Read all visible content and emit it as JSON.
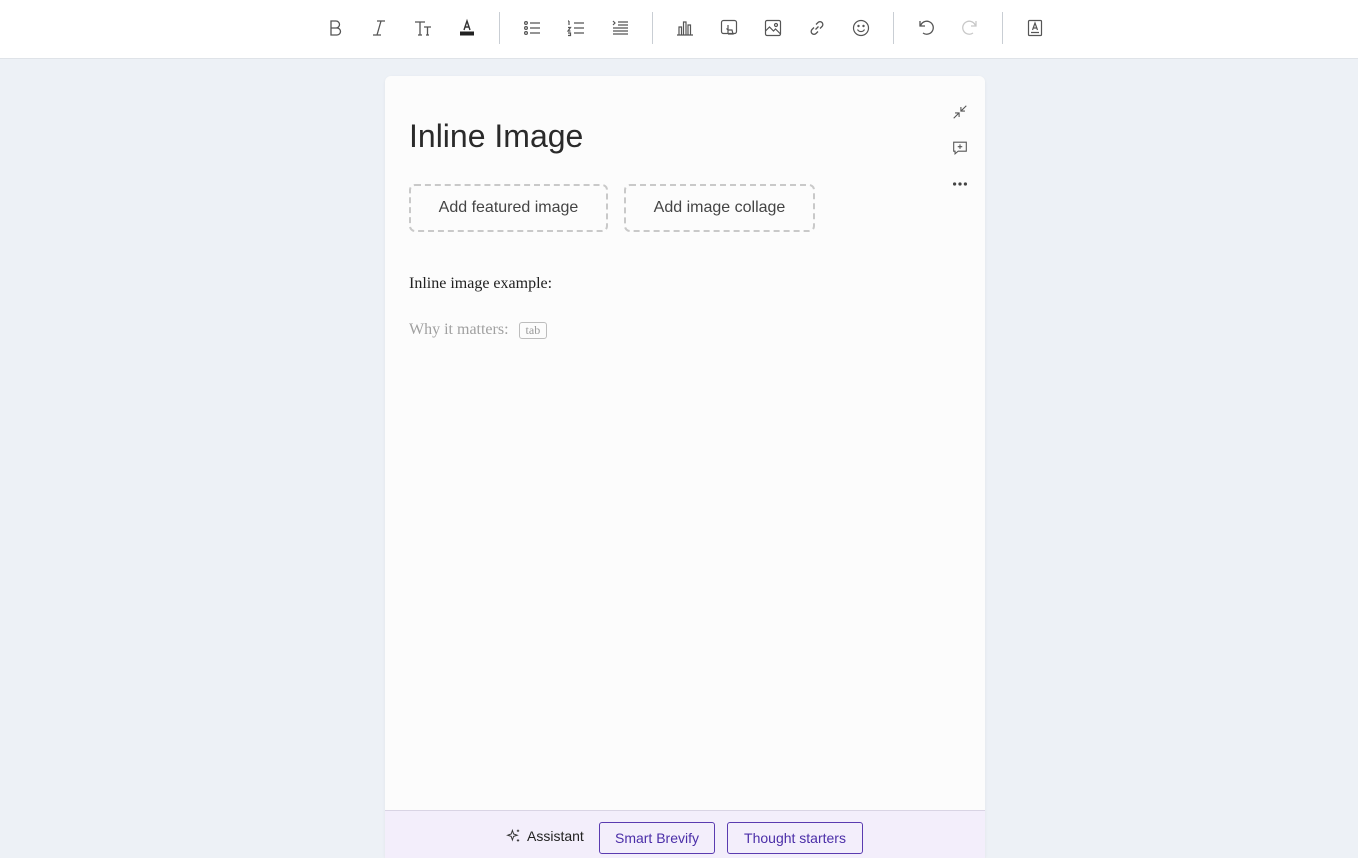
{
  "toolbar": {
    "groups": [
      [
        "bold-icon",
        "italic-icon",
        "text-size-icon",
        "text-color-icon"
      ],
      [
        "bullet-list-icon",
        "numbered-list-icon",
        "indent-list-icon"
      ],
      [
        "chart-icon",
        "interactive-icon",
        "image-icon",
        "link-icon",
        "emoji-icon"
      ],
      [
        "undo-icon",
        "redo-icon"
      ],
      [
        "text-box-icon"
      ]
    ]
  },
  "document": {
    "title": "Inline Image",
    "featured_image_label": "Add featured image",
    "image_collage_label": "Add image collage",
    "body_text": "Inline image example:",
    "placeholder_text": "Why it matters:",
    "tab_hint": "tab"
  },
  "bottom_bar": {
    "assistant_label": "Assistant",
    "smart_brevify_label": "Smart Brevify",
    "thought_starters_label": "Thought starters"
  },
  "colors": {
    "accent": "#4b2ea8",
    "background": "#edf1f6",
    "bottom_bar": "#f3eefb"
  }
}
